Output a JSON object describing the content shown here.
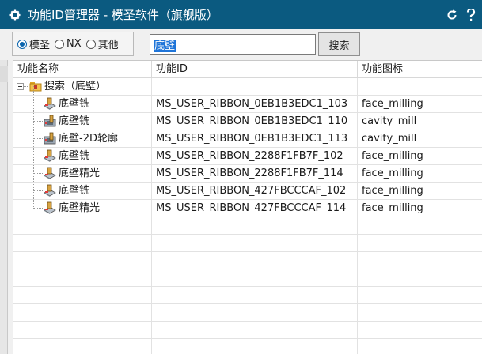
{
  "window": {
    "title": "功能ID管理器 - 模圣软件（旗舰版）",
    "colors": {
      "titlebar": "#0b5a80",
      "accent": "#0a64ad"
    }
  },
  "source_options": {
    "items": [
      {
        "label": "模圣",
        "selected": true
      },
      {
        "label": "NX",
        "selected": false
      },
      {
        "label": "其他",
        "selected": false
      }
    ]
  },
  "search": {
    "value": "底壁",
    "button_label": "搜索"
  },
  "table": {
    "columns": [
      "功能名称",
      "功能ID",
      "功能图标"
    ],
    "root": {
      "label": "搜索（底壁）",
      "icon": "folder-icon",
      "expanded": true
    },
    "rows": [
      {
        "name": "底壁铣",
        "id": "MS_USER_RIBBON_0EB1B3EDC1_103",
        "icon_name": "face_milling",
        "icon": "face-milling-icon"
      },
      {
        "name": "底壁铣",
        "id": "MS_USER_RIBBON_0EB1B3EDC1_110",
        "icon_name": "cavity_mill",
        "icon": "cavity-mill-icon"
      },
      {
        "name": "底壁-2D轮廓",
        "id": "MS_USER_RIBBON_0EB1B3EDC1_113",
        "icon_name": "cavity_mill",
        "icon": "cavity-mill-icon"
      },
      {
        "name": "底壁铣",
        "id": "MS_USER_RIBBON_2288F1FB7F_102",
        "icon_name": "face_milling",
        "icon": "face-milling-icon"
      },
      {
        "name": "底壁精光",
        "id": "MS_USER_RIBBON_2288F1FB7F_114",
        "icon_name": "face_milling",
        "icon": "face-milling-icon"
      },
      {
        "name": "底壁铣",
        "id": "MS_USER_RIBBON_427FBCCCAF_102",
        "icon_name": "face_milling",
        "icon": "face-milling-icon"
      },
      {
        "name": "底壁精光",
        "id": "MS_USER_RIBBON_427FBCCCAF_114",
        "icon_name": "face_milling",
        "icon": "face-milling-icon"
      }
    ]
  }
}
